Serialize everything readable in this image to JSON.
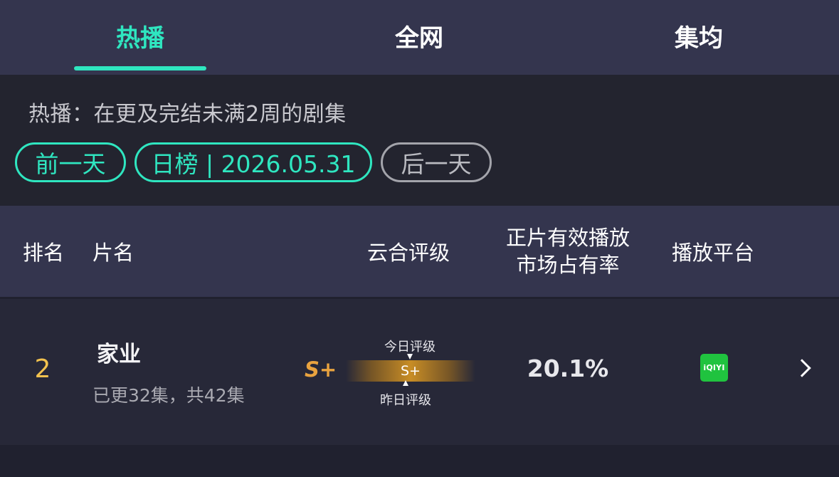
{
  "tabs": [
    {
      "label": "热播",
      "active": true
    },
    {
      "label": "全网",
      "active": false
    },
    {
      "label": "集均",
      "active": false
    }
  ],
  "info": {
    "description": "热播：在更及完结未满2周的剧集",
    "prev_day": "前一天",
    "daily_chart": "日榜 | 2026.05.31",
    "next_day": "后一天"
  },
  "table_header": {
    "rank": "排名",
    "title": "片名",
    "rating": "云合评级",
    "share_line1": "正片有效播放",
    "share_line2": "市场占有率",
    "platform": "播放平台"
  },
  "rows": [
    {
      "rank": "2",
      "title": "家业",
      "episodes": "已更32集，共42集",
      "grade": "S+",
      "today_grade_label": "今日评级",
      "bar_grade": "S+",
      "yesterday_grade_label": "昨日评级",
      "market_share": "20.1%",
      "platform": "iQIYI",
      "platform_icon": "iqiyi-logo-icon"
    }
  ],
  "colors": {
    "accent": "#2fe6c0",
    "rank": "#f2c24e",
    "grade": "#e9a33f",
    "header_bg": "#34354e",
    "platform_green": "#20c33f"
  }
}
